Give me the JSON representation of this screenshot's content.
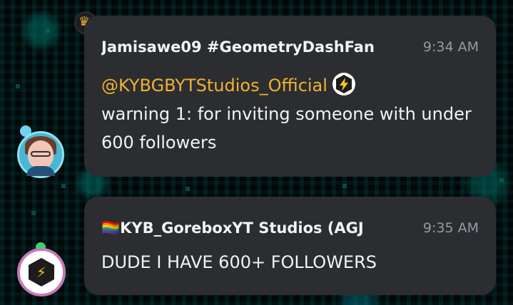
{
  "messages": [
    {
      "author": "Jamisawe09 #GeometryDashFan",
      "time": "9:34 AM",
      "mention": "@KYBGBYTStudios_Official",
      "text": "warning 1: for inviting someone with under 600 followers",
      "mention_icon": "lightning-badge-icon"
    },
    {
      "author": "🏳️‍🌈KYB_GoreboxYT Studios (AGJ",
      "time": "9:35 AM",
      "text": "DUDE I HAVE 600+ FOLLOWERS"
    }
  ],
  "colors": {
    "bubble": "#2b2d31",
    "mention": "#f0b132",
    "timestamp": "#949ba4"
  }
}
